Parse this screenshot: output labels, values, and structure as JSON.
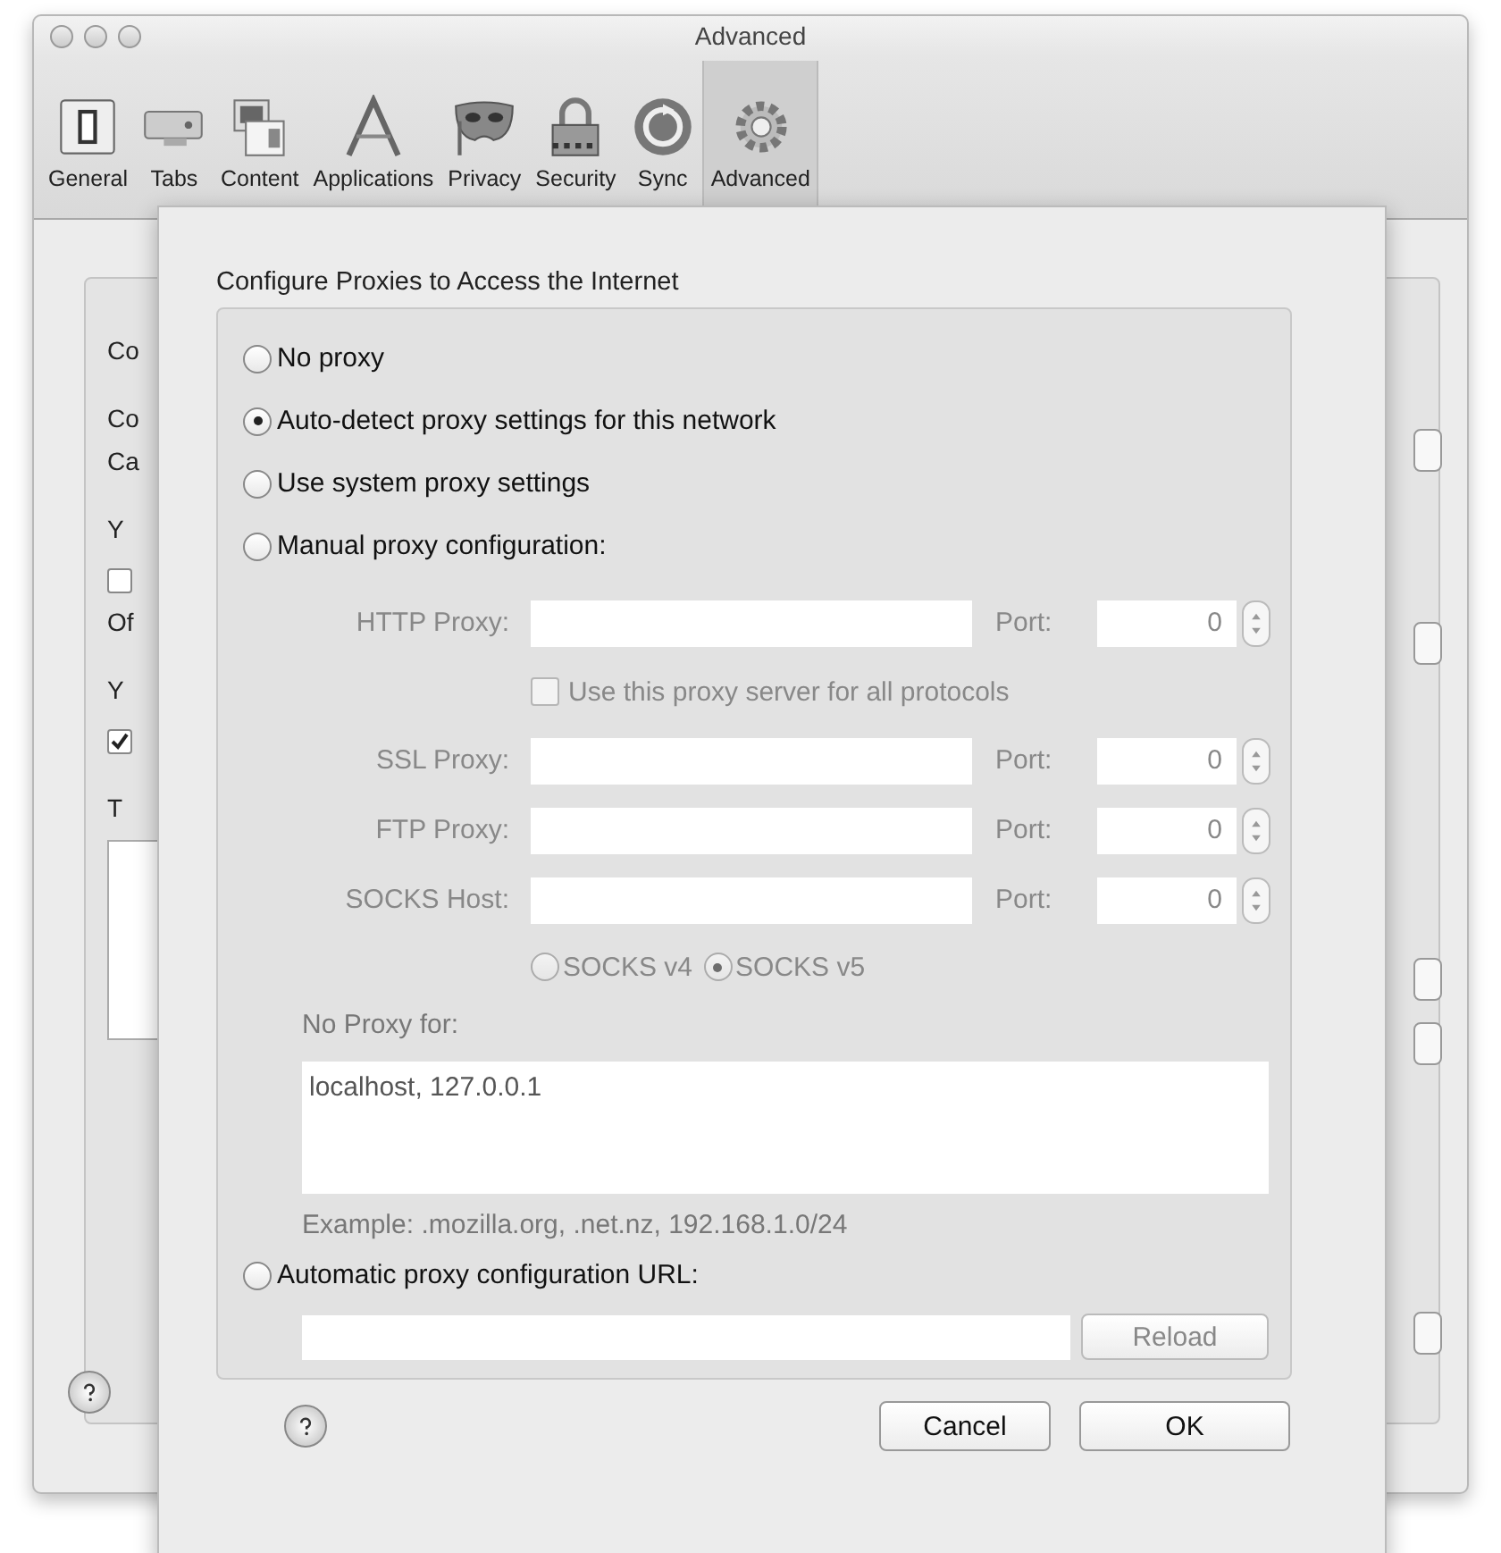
{
  "window": {
    "title": "Advanced",
    "toolbar": [
      {
        "label": "General",
        "selected": false
      },
      {
        "label": "Tabs",
        "selected": false
      },
      {
        "label": "Content",
        "selected": false
      },
      {
        "label": "Applications",
        "selected": false
      },
      {
        "label": "Privacy",
        "selected": false
      },
      {
        "label": "Security",
        "selected": false
      },
      {
        "label": "Sync",
        "selected": false
      },
      {
        "label": "Advanced",
        "selected": true
      }
    ]
  },
  "background": {
    "items": [
      {
        "kind": "heading",
        "text": "Co"
      },
      {
        "kind": "label",
        "text": "Co"
      },
      {
        "kind": "heading",
        "text": "Ca"
      },
      {
        "kind": "label",
        "text": "Y"
      },
      {
        "kind": "checkbox",
        "checked": false
      },
      {
        "kind": "heading",
        "text": "Of"
      },
      {
        "kind": "label",
        "text": "Y"
      },
      {
        "kind": "checkbox",
        "checked": true
      },
      {
        "kind": "label",
        "text": "T"
      },
      {
        "kind": "textarea"
      }
    ]
  },
  "proxy_dialog": {
    "title": "Configure Proxies to Access the Internet",
    "options": [
      {
        "label": "No proxy",
        "selected": false
      },
      {
        "label": "Auto-detect proxy settings for this network",
        "selected": true
      },
      {
        "label": "Use system proxy settings",
        "selected": false
      },
      {
        "label": "Manual proxy configuration:",
        "selected": false
      }
    ],
    "manual": {
      "disabled": true,
      "rows": [
        {
          "kind": "proxy",
          "label": "HTTP Proxy:",
          "port_label": "Port:",
          "port": "0"
        },
        {
          "kind": "checkbox",
          "label": "Use this proxy server for all protocols",
          "checked": false
        },
        {
          "kind": "proxy",
          "label": "SSL Proxy:",
          "port_label": "Port:",
          "port": "0"
        },
        {
          "kind": "proxy",
          "label": "FTP Proxy:",
          "port_label": "Port:",
          "port": "0"
        },
        {
          "kind": "proxy",
          "label": "SOCKS Host:",
          "port_label": "Port:",
          "port": "0"
        }
      ],
      "socks_versions": [
        {
          "label": "SOCKS v4",
          "selected": false
        },
        {
          "label": "SOCKS v5",
          "selected": true
        }
      ]
    },
    "no_proxy_label": "No Proxy for:",
    "no_proxy_value": "localhost, 127.0.0.1",
    "example": "Example: .mozilla.org, .net.nz, 192.168.1.0/24",
    "auto_url": {
      "label": "Automatic proxy configuration URL:",
      "selected": false,
      "reload": "Reload",
      "reload_disabled": true
    },
    "buttons": [
      "Cancel",
      "OK"
    ]
  }
}
